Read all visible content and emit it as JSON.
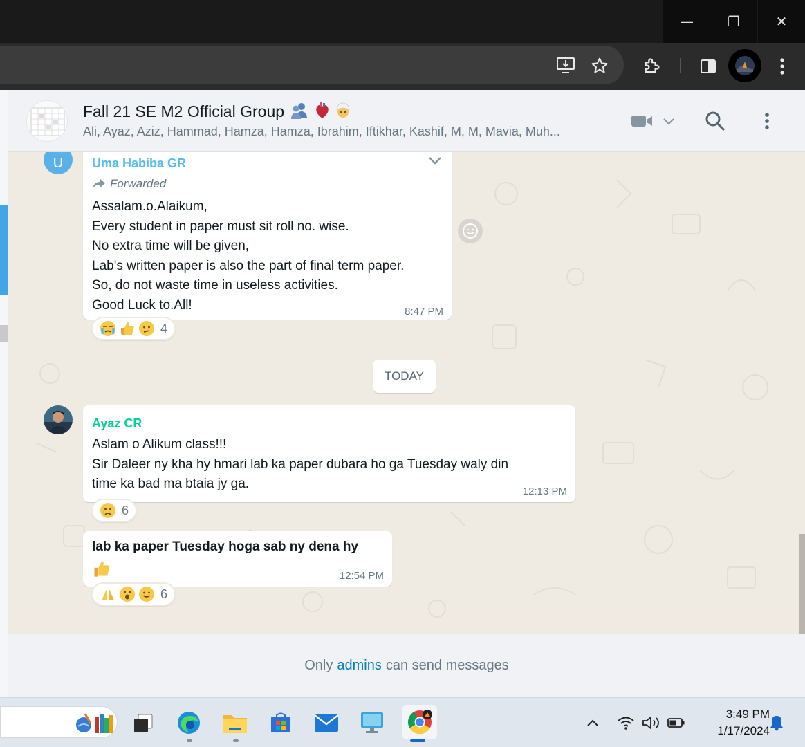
{
  "colors": {
    "background": "#efeae2",
    "uma_sender": "#53bdeb",
    "ayaz_sender": "#06cf9c",
    "link": "#027eb5",
    "time": "#667781"
  },
  "window_controls": {
    "minimize": "—",
    "maximize": "❐",
    "close": "✕"
  },
  "chat_header": {
    "group_name": "Fall 21 SE M2 Official Group",
    "members": "Ali, Ayaz, Aziz, Hammad, Hamza, Hamza, Ibrahim, Iftikhar, Kashif, M, M, Mavia, Muh..."
  },
  "messages": [
    {
      "avatar_letter": "U",
      "sender": "Uma Habiba GR",
      "forwarded_label": "Forwarded",
      "text": "Assalam.o.Alaikum,\nEvery student in paper must sit roll no. wise.\nNo extra time will be given,\nLab's written paper is also the part of final term paper.\nSo, do not waste time in useless activities.\nGood Luck to.All!",
      "time": "8:47 PM",
      "reaction_count": "4"
    },
    {
      "sender": "Ayaz CR",
      "text": "Aslam o Alikum class!!!\nSir Daleer ny kha hy hmari lab ka paper dubara ho ga Tuesday waly din\ntime ka bad ma btaia jy ga.",
      "time": "12:13 PM",
      "reaction_count": "6"
    },
    {
      "text": "lab ka paper Tuesday hoga sab ny dena hy",
      "time": "12:54 PM",
      "reaction_count": "6"
    }
  ],
  "date_divider": "TODAY",
  "footer": {
    "prefix": "Only",
    "link": "admins",
    "suffix": "can send messages"
  },
  "taskbar": {
    "time": "3:49 PM",
    "date": "1/17/2024"
  }
}
